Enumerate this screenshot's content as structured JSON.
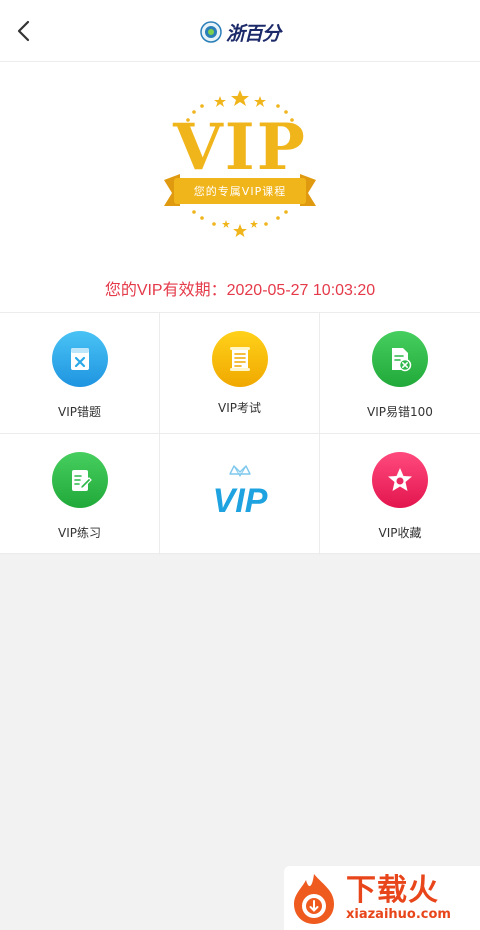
{
  "header": {
    "brand_name": "浙百分"
  },
  "hero": {
    "vip_title": "VIP",
    "ribbon_text": "您的专属VIP课程",
    "expiry_text": "您的VIP有效期：2020-05-27 10:03:20",
    "accent_color": "#f1b51c",
    "expiry_color": "#e53a4a"
  },
  "grid": {
    "items": [
      {
        "label": "VIP错题",
        "icon": "mistake-book-icon",
        "color": "#2aa8e8"
      },
      {
        "label": "VIP考试",
        "icon": "exam-scroll-icon",
        "color": "#f5b800"
      },
      {
        "label": "VIP易错100",
        "icon": "error-doc-icon",
        "color": "#2db84a"
      },
      {
        "label": "VIP练习",
        "icon": "practice-edit-icon",
        "color": "#2db84a"
      },
      {
        "label": "VIP",
        "icon": "vip-crown-logo",
        "color": "#1ea3e0"
      },
      {
        "label": "VIP收藏",
        "icon": "favorite-star-icon",
        "color": "#ea2b63"
      }
    ]
  },
  "watermark": {
    "main": "下载火",
    "sub": "xiazaihuo.com"
  }
}
